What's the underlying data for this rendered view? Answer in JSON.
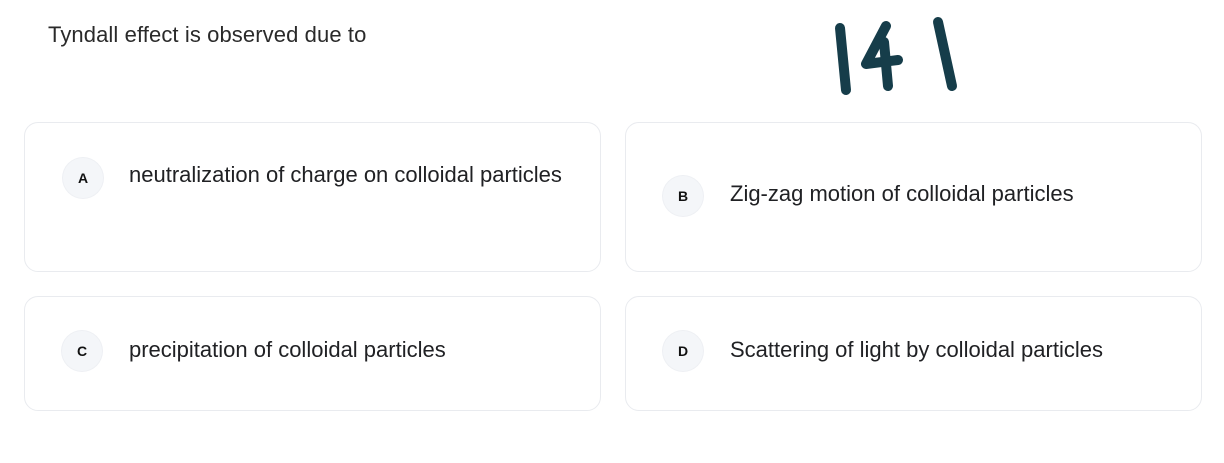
{
  "question": {
    "text": "Tyndall effect is observed due to"
  },
  "handwritten_note": {
    "text": "141",
    "color": "#163d4a"
  },
  "options": [
    {
      "letter": "A",
      "text": "neutralization of charge on colloidal particles"
    },
    {
      "letter": "B",
      "text": "Zig-zag motion of colloidal particles"
    },
    {
      "letter": "C",
      "text": "precipitation of colloidal particles"
    },
    {
      "letter": "D",
      "text": "Scattering of light by colloidal particles"
    }
  ]
}
